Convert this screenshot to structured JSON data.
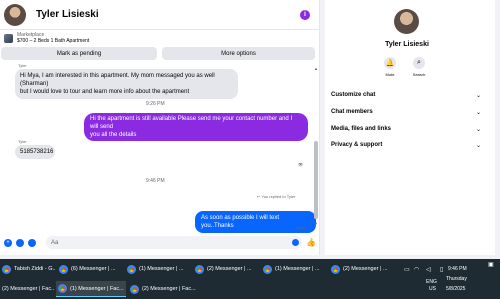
{
  "chat": {
    "contact_name": "Tyler Lisieski",
    "marketplace_label": "Marketplace",
    "listing_title": "$700 – 2 Beds 1 Bath Apartment",
    "mark_pending_label": "Mark as pending",
    "more_options_label": "More options",
    "messages": [
      {
        "sender": "Tyler",
        "text_line1": "Hi Mya, I am interested in this apartment. My mom messaged you as well (Sharman)",
        "text_line2": "but I would love to tour and learn more info about the apartment"
      },
      {
        "timestamp": "9:26 PM"
      },
      {
        "text_line1": "Hi the apartment is still available Please send me your contact number and I will send",
        "text_line2": "you all the details"
      },
      {
        "sender": "Tyler",
        "text": "5185738216"
      },
      {
        "timestamp": "9:46 PM"
      },
      {
        "reply_note": "You replied to Tyler",
        "text": "As soon as possible I will text you..Thanks",
        "status": "Sent"
      }
    ],
    "composer_placeholder": "Aa"
  },
  "info_panel": {
    "name": "Tyler Lisieski",
    "mute_label": "Mute",
    "search_label": "Search",
    "sections": [
      "Customize chat",
      "Chat members",
      "Media, files and links",
      "Privacy & support"
    ]
  },
  "taskbar": {
    "row1": [
      "Tabish Ziddi - G...",
      "(6) Messenger | ...",
      "(1) Messenger | ...",
      "(2) Messenger | ...",
      "(1) Messenger | ...",
      "(2) Messenger | ..."
    ],
    "row2": [
      "(2) Messenger | Fac...",
      "(1) Messenger | Fac...",
      "(2) Messenger | Fac..."
    ],
    "lang": "ENG",
    "region": "US",
    "time": "9:46 PM",
    "day": "Thursday",
    "date": "5/8/2025"
  },
  "colors": {
    "accent_purple": "#8a2be2",
    "accent_blue": "#0866ff",
    "taskbar_bg": "#1f2b33"
  },
  "icons": [
    "info-icon",
    "mute-bell-icon",
    "search-icon",
    "chevron-down-icon",
    "like-icon",
    "emoji-icon",
    "plus-icon",
    "chrome-icon",
    "wifi-icon",
    "volume-icon",
    "battery-icon"
  ]
}
